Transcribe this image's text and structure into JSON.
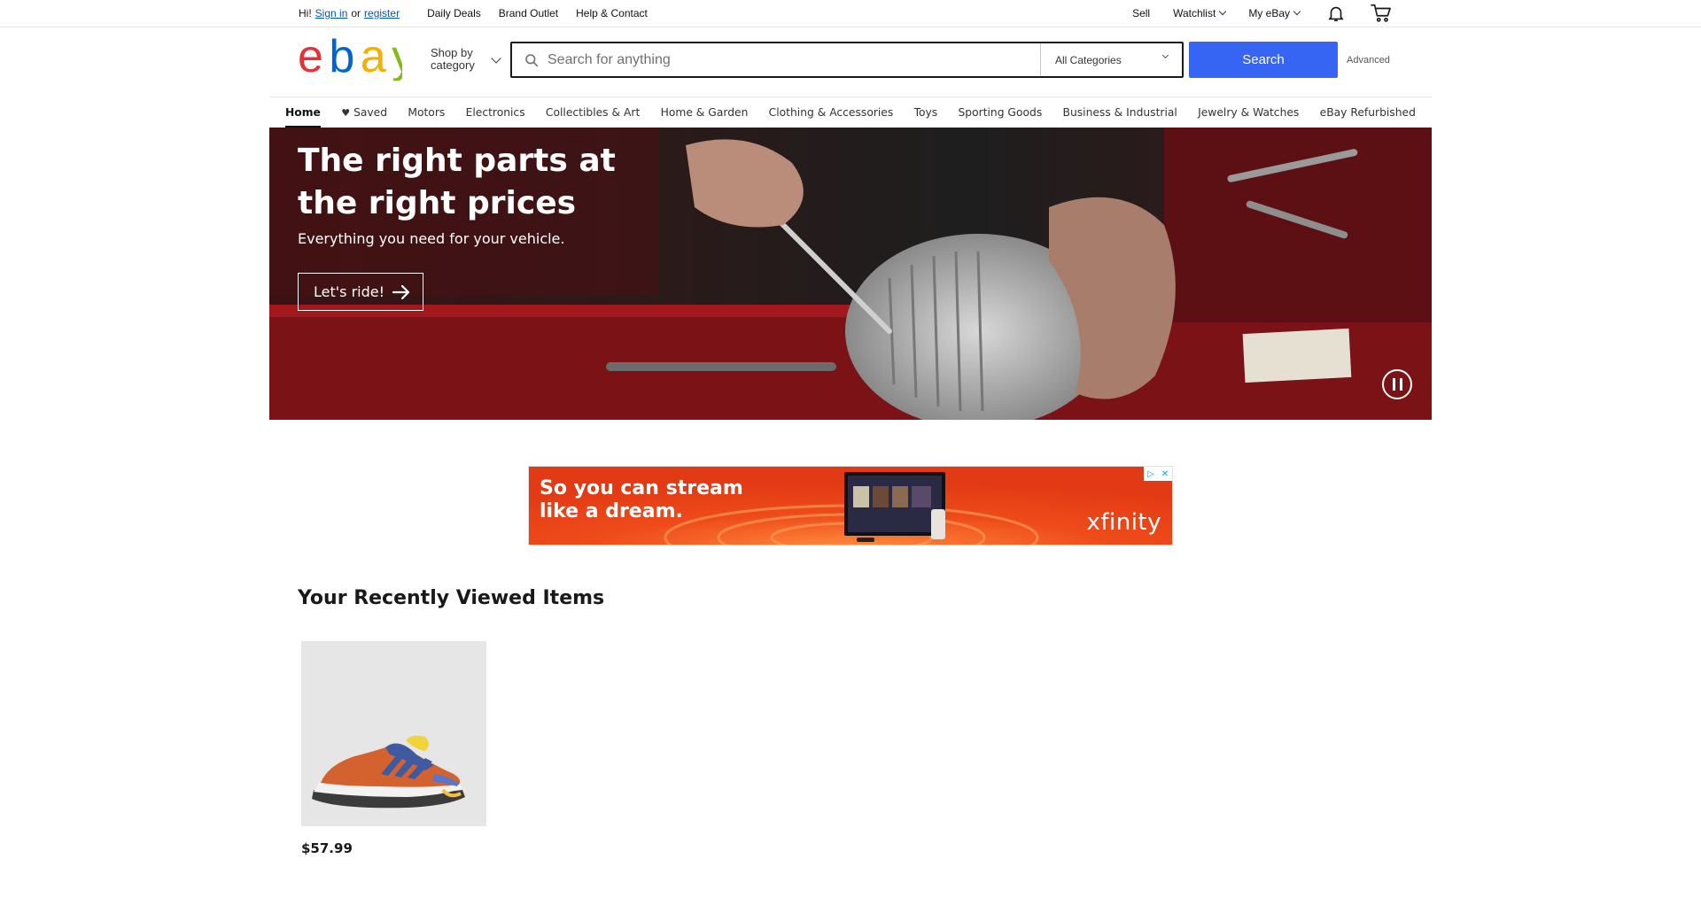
{
  "topbar": {
    "greeting_prefix": "Hi!",
    "sign_in": "Sign in",
    "or": "or",
    "register": "register",
    "links": [
      "Daily Deals",
      "Brand Outlet",
      "Help & Contact"
    ],
    "sell": "Sell",
    "watchlist": "Watchlist",
    "my_ebay": "My eBay",
    "notification_icon": "bell-icon",
    "cart_icon": "cart-icon"
  },
  "header": {
    "logo_letters": [
      "e",
      "b",
      "a",
      "y"
    ],
    "logo_colors": [
      "#e53238",
      "#0064d2",
      "#f5af02",
      "#86b817"
    ],
    "shop_by_category": "Shop by category",
    "search_placeholder": "Search for anything",
    "category_selected": "All Categories",
    "search_button": "Search",
    "advanced": "Advanced",
    "accent_color": "#3665f3"
  },
  "nav": {
    "items": [
      {
        "label": "Home",
        "active": true
      },
      {
        "label": "Saved"
      },
      {
        "label": "Motors"
      },
      {
        "label": "Electronics"
      },
      {
        "label": "Collectibles & Art"
      },
      {
        "label": "Home & Garden"
      },
      {
        "label": "Clothing & Accessories"
      },
      {
        "label": "Toys"
      },
      {
        "label": "Sporting Goods"
      },
      {
        "label": "Business & Industrial"
      },
      {
        "label": "Jewelry & Watches"
      },
      {
        "label": "eBay Refurbished"
      }
    ]
  },
  "hero": {
    "title": "The right parts at the right prices",
    "subtitle": "Everything you need for your vehicle.",
    "cta": "Let's ride!"
  },
  "ad": {
    "headline": "So you can stream like a dream.",
    "brand": "xfinity"
  },
  "recently_viewed": {
    "title": "Your Recently Viewed Items",
    "items": [
      {
        "price": "$57.99"
      }
    ]
  }
}
